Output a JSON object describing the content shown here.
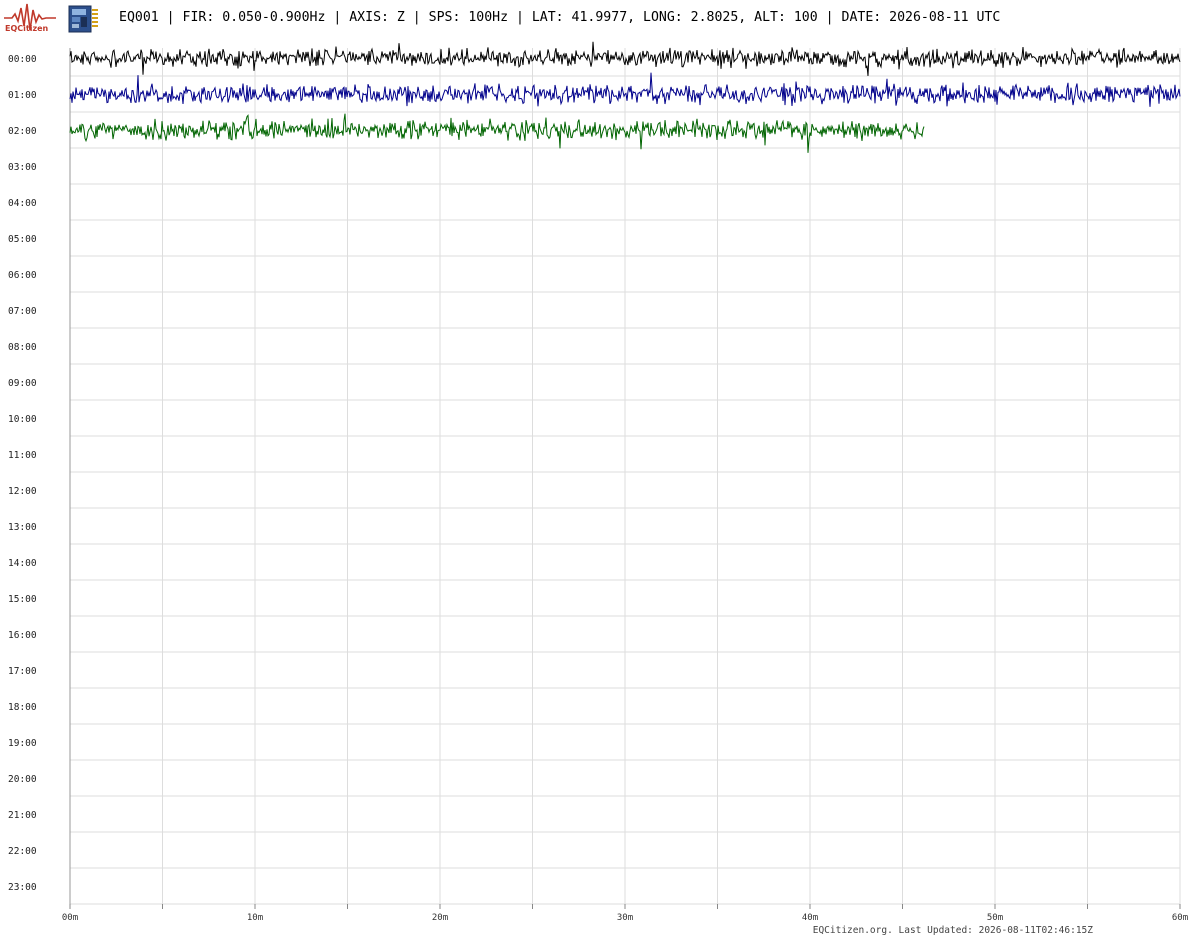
{
  "header": {
    "logo_text": "EQCitizen",
    "title": "EQ001 | FIR: 0.050-0.900Hz | AXIS: Z | SPS: 100Hz | LAT: 41.9977, LONG: 2.8025, ALT: 100 | DATE: 2026-08-11 UTC",
    "logo_icon": "seismograph-logo-icon",
    "device_icon": "sensor-board-icon"
  },
  "chart_data": {
    "type": "line",
    "title": "EQ001 | FIR: 0.050-0.900Hz | AXIS: Z | SPS: 100Hz | LAT: 41.9977, LONG: 2.8025, ALT: 100 | DATE: 2026-08-11 UTC",
    "xlabel": "",
    "ylabel": "",
    "x_ticks": [
      "00m",
      "10m",
      "20m",
      "30m",
      "40m",
      "50m",
      "60m"
    ],
    "x_range_minutes": [
      0,
      60
    ],
    "x_minor_step_minutes": 5,
    "y_ticks": [
      "00:00",
      "01:00",
      "02:00",
      "03:00",
      "04:00",
      "05:00",
      "06:00",
      "07:00",
      "08:00",
      "09:00",
      "10:00",
      "11:00",
      "12:00",
      "13:00",
      "14:00",
      "15:00",
      "16:00",
      "17:00",
      "18:00",
      "19:00",
      "20:00",
      "21:00",
      "22:00",
      "23:00"
    ],
    "grid": true,
    "series": [
      {
        "row": "00:00",
        "end_minute": 60,
        "amplitude": 0.12,
        "color": "#000000"
      },
      {
        "row": "01:00",
        "end_minute": 60,
        "amplitude": 0.13,
        "color": "#00008b"
      },
      {
        "row": "02:00",
        "end_minute": 46.2,
        "amplitude": 0.13,
        "color": "#006400"
      }
    ]
  },
  "colors": {
    "grid": "#dddddd",
    "brand": "#c0392b"
  },
  "footer": {
    "text": "EQCitizen.org. Last Updated: 2026-08-11T02:46:15Z"
  }
}
